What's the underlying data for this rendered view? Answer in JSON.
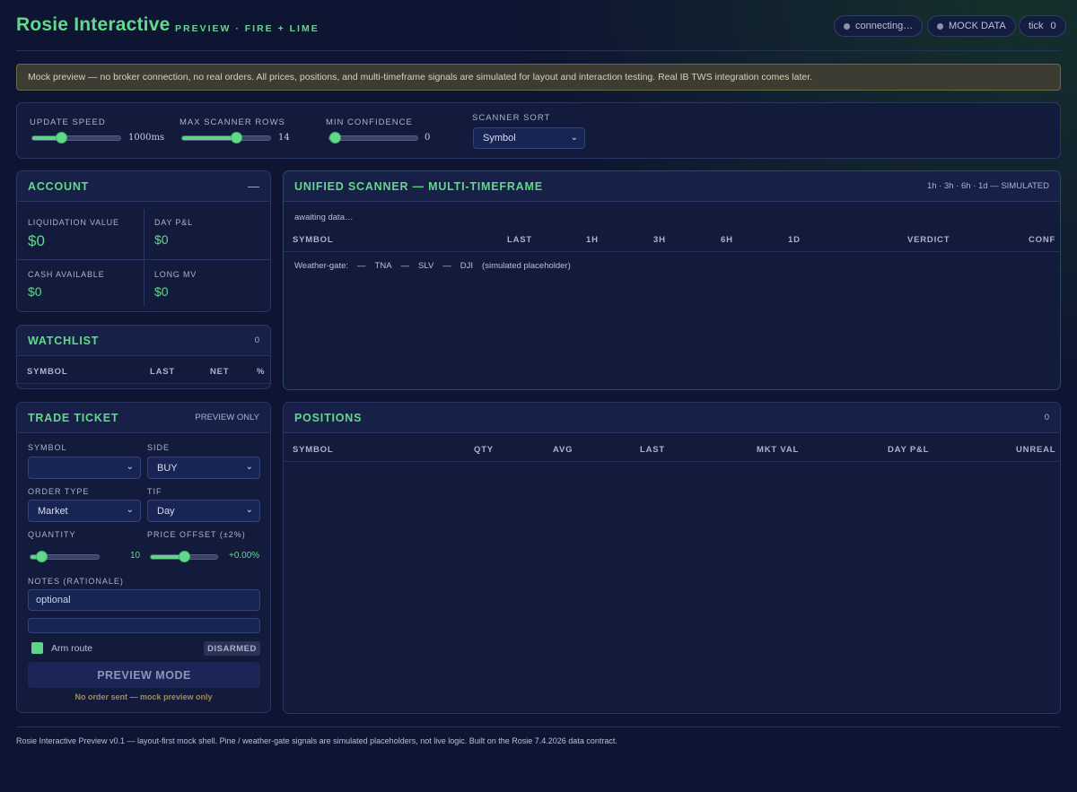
{
  "header": {
    "title": "Rosie Interactive",
    "subtitle": "PREVIEW · FIRE + LIME",
    "status_label": "connecting…",
    "mock_label": "MOCK DATA",
    "tick_label": "tick",
    "tick_value": "0"
  },
  "banner": {
    "text": "Mock preview — no broker connection, no real orders. All prices, positions, and multi-timeframe signals are simulated for layout and interaction testing. Real IB TWS integration comes later."
  },
  "controls": {
    "update_speed": {
      "label": "UPDATE SPEED",
      "value": "1000ms",
      "fraction": 0.3
    },
    "max_rows": {
      "label": "MAX SCANNER ROWS",
      "value": "14",
      "fraction": 0.63
    },
    "min_confidence": {
      "label": "MIN CONFIDENCE",
      "value": "0",
      "fraction": 0.0
    },
    "scanner_sort": {
      "label": "SCANNER SORT",
      "value": "Symbol"
    }
  },
  "account": {
    "title": "ACCOUNT",
    "collapse": "—",
    "cells": [
      {
        "label": "LIQUIDATION VALUE",
        "value": "$0"
      },
      {
        "label": "DAY P&L",
        "value": "$0"
      },
      {
        "label": "CASH AVAILABLE",
        "value": "$0"
      },
      {
        "label": "LONG MV",
        "value": "$0"
      }
    ]
  },
  "watchlist": {
    "title": "WATCHLIST",
    "count": "0",
    "columns": [
      "SYMBOL",
      "LAST",
      "NET",
      "%"
    ]
  },
  "scanner": {
    "title": "UNIFIED SCANNER — MULTI-TIMEFRAME",
    "meta": "1h · 3h · 6h · 1d — SIMULATED",
    "status": "awaiting data…",
    "columns": [
      "SYMBOL",
      "LAST",
      "1H",
      "3H",
      "6H",
      "1D",
      "VERDICT",
      "CONF"
    ],
    "weather": {
      "label": "Weather-gate:",
      "items": [
        "—",
        "TNA",
        "—",
        "SLV",
        "—",
        "DJI"
      ],
      "note": "(simulated placeholder)"
    }
  },
  "ticket": {
    "title": "TRADE TICKET",
    "meta": "PREVIEW ONLY",
    "symbol_label": "SYMBOL",
    "symbol_value": "",
    "side_label": "SIDE",
    "side_value": "BUY",
    "order_type_label": "ORDER TYPE",
    "order_type_value": "Market",
    "tif_label": "TIF",
    "tif_value": "Day",
    "quantity_label": "QUANTITY",
    "quantity_value": "10",
    "quantity_fraction": 0.1,
    "offset_label": "PRICE OFFSET (±2%)",
    "offset_value": "+0.00%",
    "offset_fraction": 0.5,
    "notes_label": "NOTES (RATIONALE)",
    "notes_placeholder": "optional",
    "arm_label": "Arm route",
    "armed_status": "DISARMED",
    "submit_label": "PREVIEW MODE",
    "note": "No order sent — mock preview only"
  },
  "positions": {
    "title": "POSITIONS",
    "count": "0",
    "columns": [
      "SYMBOL",
      "QTY",
      "AVG",
      "LAST",
      "MKT VAL",
      "DAY P&L",
      "UNREAL"
    ]
  },
  "footer": {
    "text": "Rosie Interactive Preview v0.1 — layout-first mock shell. Pine / weather-gate signals are simulated placeholders, not live logic. Built on the Rosie 7.4.2026 data contract."
  },
  "colors": {
    "accent": "#62d88a",
    "background": "#0e1532",
    "panel": "#131b3d",
    "warning_banner": "#3d3c32"
  }
}
